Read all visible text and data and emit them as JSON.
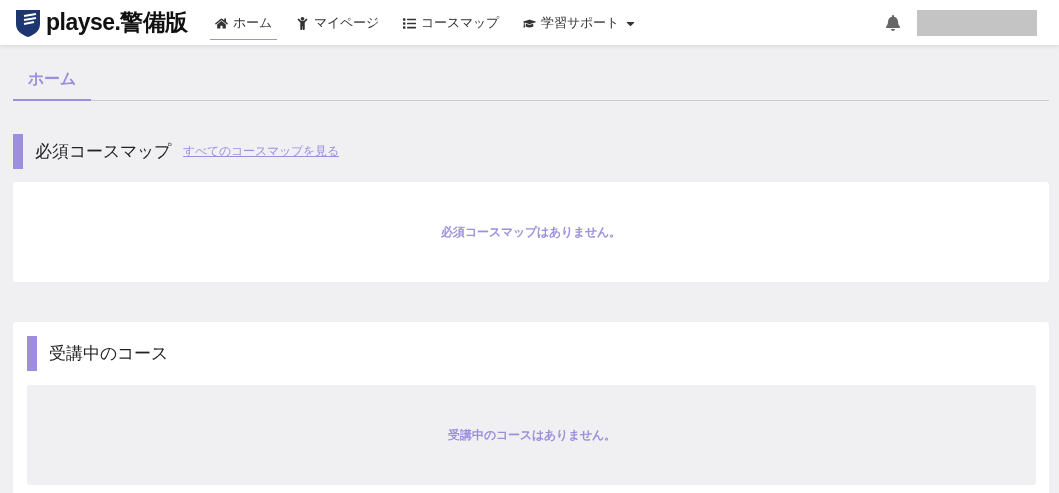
{
  "header": {
    "logo": "playse.警備版",
    "nav": [
      {
        "label": "ホーム",
        "kind": "home",
        "selected": true,
        "dropdown": false
      },
      {
        "label": "マイページ",
        "kind": "person",
        "selected": false,
        "dropdown": false
      },
      {
        "label": "コースマップ",
        "kind": "list",
        "selected": false,
        "dropdown": false
      },
      {
        "label": "学習サポート",
        "kind": "cap",
        "selected": false,
        "dropdown": true
      }
    ]
  },
  "tabs": [
    {
      "label": "ホーム",
      "selected": true
    }
  ],
  "required_section": {
    "title": "必須コースマップ",
    "link": "すべてのコースマップを見る",
    "empty_message": "必須コースマップはありません。"
  },
  "in_progress_section": {
    "title": "受講中のコース",
    "empty_message": "受講中のコースはありません。"
  }
}
